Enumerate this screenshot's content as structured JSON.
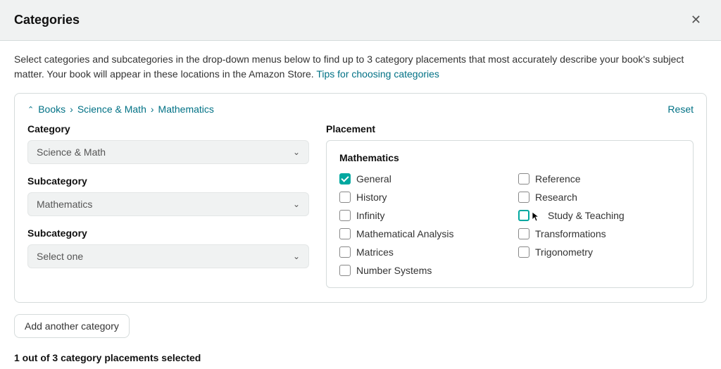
{
  "header": {
    "title": "Categories"
  },
  "intro": {
    "text": "Select categories and subcategories in the drop-down menus below to find up to 3 category placements that most accurately describe your book's subject matter. Your book will appear in these locations in the Amazon Store. ",
    "link_text": "Tips for choosing categories"
  },
  "breadcrumb": {
    "parts": [
      "Books",
      "Science & Math",
      "Mathematics"
    ]
  },
  "reset_label": "Reset",
  "left": {
    "category_label": "Category",
    "category_value": "Science & Math",
    "subcategory1_label": "Subcategory",
    "subcategory1_value": "Mathematics",
    "subcategory2_label": "Subcategory",
    "subcategory2_value": "Select one"
  },
  "right": {
    "placement_label": "Placement",
    "placement_group_title": "Mathematics",
    "options_left": [
      {
        "label": "General",
        "checked": true
      },
      {
        "label": "History",
        "checked": false
      },
      {
        "label": "Infinity",
        "checked": false
      },
      {
        "label": "Mathematical Analysis",
        "checked": false
      },
      {
        "label": "Matrices",
        "checked": false
      },
      {
        "label": "Number Systems",
        "checked": false
      }
    ],
    "options_right": [
      {
        "label": "Reference",
        "checked": false
      },
      {
        "label": "Research",
        "checked": false
      },
      {
        "label": "Study & Teaching",
        "checked": false,
        "highlighted": true,
        "cursor": true
      },
      {
        "label": "Transformations",
        "checked": false
      },
      {
        "label": "Trigonometry",
        "checked": false
      }
    ]
  },
  "add_button": "Add another category",
  "status": "1 out of 3 category placements selected"
}
